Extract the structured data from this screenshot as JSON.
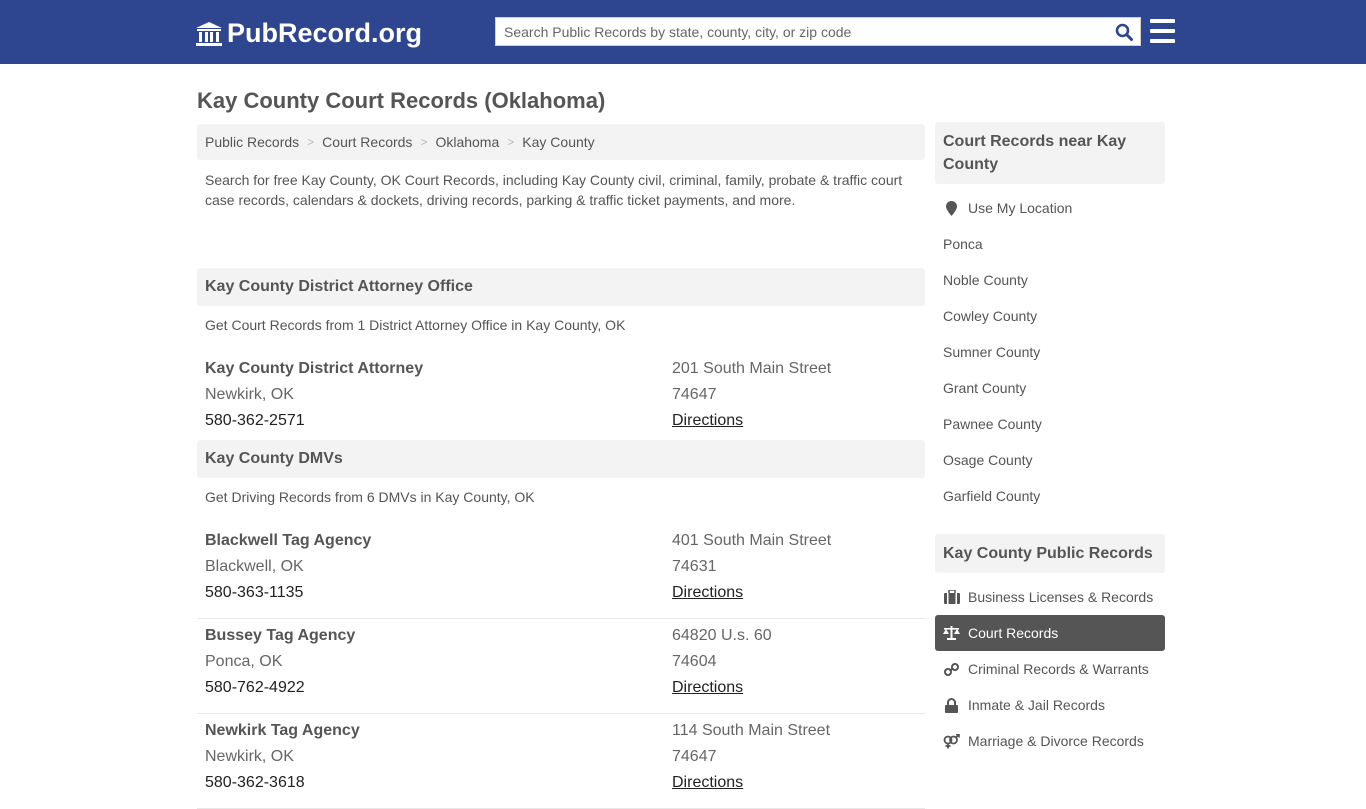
{
  "header": {
    "logo_text": "PubRecord.org",
    "search_placeholder": "Search Public Records by state, county, city, or zip code",
    "brand_color": "#2e4690"
  },
  "page_title": "Kay County Court Records (Oklahoma)",
  "breadcrumb": [
    "Public Records",
    "Court Records",
    "Oklahoma",
    "Kay County"
  ],
  "intro": "Search for free Kay County, OK Court Records, including Kay County civil, criminal, family, probate & traffic court case records, calendars & dockets, driving records, parking & traffic ticket payments, and more.",
  "sections": [
    {
      "title": "Kay County District Attorney Office",
      "subtitle": "Get Court Records from 1 District Attorney Office in Kay County, OK",
      "entries": [
        {
          "name": "Kay County District Attorney",
          "city": "Newkirk, OK",
          "phone": "580-362-2571",
          "street": "201 South Main Street",
          "zip": "74647",
          "link": "Directions"
        }
      ]
    },
    {
      "title": "Kay County DMVs",
      "subtitle": "Get Driving Records from 6 DMVs in Kay County, OK",
      "entries": [
        {
          "name": "Blackwell Tag Agency",
          "city": "Blackwell, OK",
          "phone": "580-363-1135",
          "street": "401 South Main Street",
          "zip": "74631",
          "link": "Directions"
        },
        {
          "name": "Bussey Tag Agency",
          "city": "Ponca, OK",
          "phone": "580-762-4922",
          "street": "64820 U.s. 60",
          "zip": "74604",
          "link": "Directions"
        },
        {
          "name": "Newkirk Tag Agency",
          "city": "Newkirk, OK",
          "phone": "580-362-3618",
          "street": "114 South Main Street",
          "zip": "74647",
          "link": "Directions"
        }
      ]
    }
  ],
  "sidebar": {
    "nearby_title": "Court Records near Kay County",
    "use_location": "Use My Location",
    "nearby": [
      "Ponca",
      "Noble County",
      "Cowley County",
      "Sumner County",
      "Grant County",
      "Pawnee County",
      "Osage County",
      "Garfield County"
    ],
    "public_title": "Kay County Public Records",
    "public": [
      {
        "label": "Business Licenses & Records",
        "icon": "briefcase-icon"
      },
      {
        "label": "Court Records",
        "icon": "scales-icon",
        "active": true
      },
      {
        "label": "Criminal Records & Warrants",
        "icon": "link-icon"
      },
      {
        "label": "Inmate & Jail Records",
        "icon": "lock-icon"
      },
      {
        "label": "Marriage & Divorce Records",
        "icon": "venus-mars-icon"
      }
    ]
  }
}
